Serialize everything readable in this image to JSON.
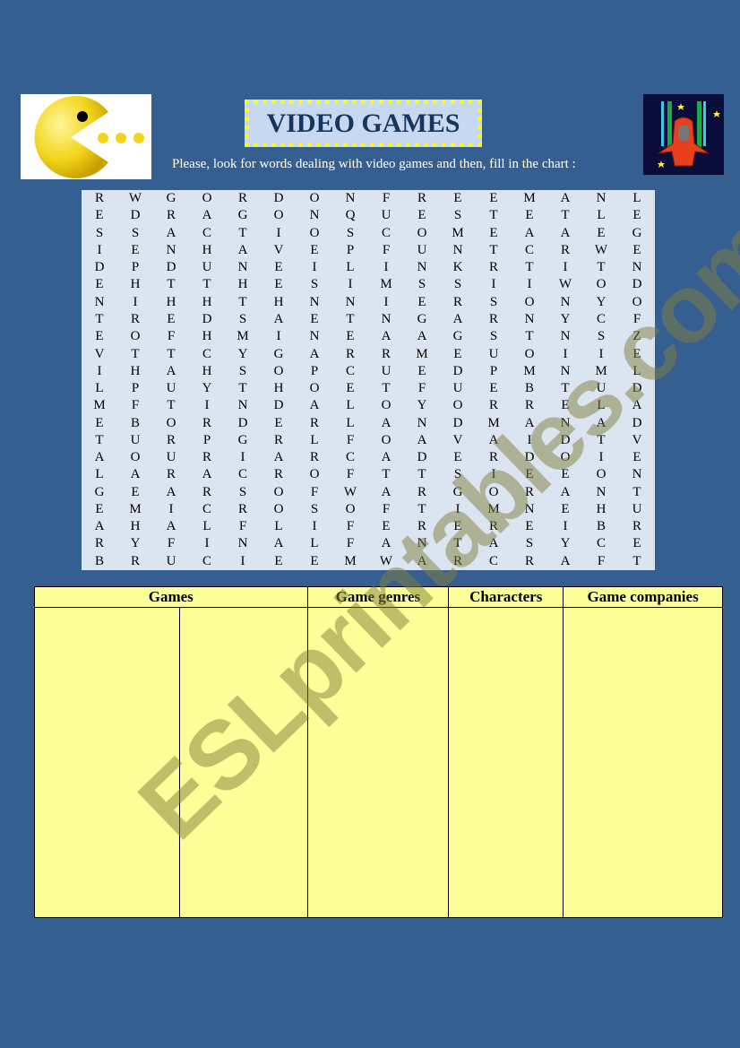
{
  "header": {
    "title": "VIDEO GAMES",
    "instructions": "Please, look for words dealing with video games and then, fill in the chart :",
    "left_image": "pacman-icon",
    "right_image": "spaceship-icon"
  },
  "word_search": {
    "rows": [
      [
        "R",
        "W",
        "G",
        "O",
        "R",
        "D",
        "O",
        "N",
        "F",
        "R",
        "E",
        "E",
        "M",
        "A",
        "N",
        "L"
      ],
      [
        "E",
        "D",
        "R",
        "A",
        "G",
        "O",
        "N",
        "Q",
        "U",
        "E",
        "S",
        "T",
        "E",
        "T",
        "L",
        "E"
      ],
      [
        "S",
        "S",
        "A",
        "C",
        "T",
        "I",
        "O",
        "S",
        "C",
        "O",
        "M",
        "E",
        "A",
        "A",
        "E",
        "G"
      ],
      [
        "I",
        "E",
        "N",
        "H",
        "A",
        "V",
        "E",
        "P",
        "F",
        "U",
        "N",
        "T",
        "C",
        "R",
        "W",
        "E"
      ],
      [
        "D",
        "P",
        "D",
        "U",
        "N",
        "E",
        "I",
        "L",
        "I",
        "N",
        "K",
        "R",
        "T",
        "I",
        "T",
        "N"
      ],
      [
        "E",
        "H",
        "T",
        "T",
        "H",
        "E",
        "S",
        "I",
        "M",
        "S",
        "S",
        "I",
        "I",
        "W",
        "O",
        "D"
      ],
      [
        "N",
        "I",
        "H",
        "H",
        "T",
        "H",
        "N",
        "N",
        "I",
        "E",
        "R",
        "S",
        "O",
        "N",
        "Y",
        "O"
      ],
      [
        "T",
        "R",
        "E",
        "D",
        "S",
        "A",
        "E",
        "T",
        "N",
        "G",
        "A",
        "R",
        "N",
        "Y",
        "C",
        "F"
      ],
      [
        "E",
        "O",
        "F",
        "H",
        "M",
        "I",
        "N",
        "E",
        "A",
        "A",
        "G",
        "S",
        "T",
        "N",
        "S",
        "Z"
      ],
      [
        "V",
        "T",
        "T",
        "C",
        "Y",
        "G",
        "A",
        "R",
        "R",
        "M",
        "E",
        "U",
        "O",
        "I",
        "I",
        "E"
      ],
      [
        "I",
        "H",
        "A",
        "H",
        "S",
        "O",
        "P",
        "C",
        "U",
        "E",
        "D",
        "P",
        "M",
        "N",
        "M",
        "L"
      ],
      [
        "L",
        "P",
        "U",
        "Y",
        "T",
        "H",
        "O",
        "E",
        "T",
        "F",
        "U",
        "E",
        "B",
        "T",
        "U",
        "D"
      ],
      [
        "M",
        "F",
        "T",
        "I",
        "N",
        "D",
        "A",
        "L",
        "O",
        "Y",
        "O",
        "R",
        "R",
        "E",
        "L",
        "A"
      ],
      [
        "E",
        "B",
        "O",
        "R",
        "D",
        "E",
        "R",
        "L",
        "A",
        "N",
        "D",
        "M",
        "A",
        "N",
        "A",
        "D"
      ],
      [
        "T",
        "U",
        "R",
        "P",
        "G",
        "R",
        "L",
        "F",
        "O",
        "A",
        "V",
        "A",
        "I",
        "D",
        "T",
        "V"
      ],
      [
        "A",
        "O",
        "U",
        "R",
        "I",
        "A",
        "R",
        "C",
        "A",
        "D",
        "E",
        "R",
        "D",
        "O",
        "I",
        "E"
      ],
      [
        "L",
        "A",
        "R",
        "A",
        "C",
        "R",
        "O",
        "F",
        "T",
        "T",
        "S",
        "I",
        "E",
        "E",
        "O",
        "N"
      ],
      [
        "G",
        "E",
        "A",
        "R",
        "S",
        "O",
        "F",
        "W",
        "A",
        "R",
        "G",
        "O",
        "R",
        "A",
        "N",
        "T"
      ],
      [
        "E",
        "M",
        "I",
        "C",
        "R",
        "O",
        "S",
        "O",
        "F",
        "T",
        "I",
        "M",
        "N",
        "E",
        "H",
        "U"
      ],
      [
        "A",
        "H",
        "A",
        "L",
        "F",
        "L",
        "I",
        "F",
        "E",
        "R",
        "E",
        "R",
        "E",
        "I",
        "B",
        "R"
      ],
      [
        "R",
        "Y",
        "F",
        "I",
        "N",
        "A",
        "L",
        "F",
        "A",
        "N",
        "T",
        "A",
        "S",
        "Y",
        "C",
        "E"
      ],
      [
        "B",
        "R",
        "U",
        "C",
        "I",
        "E",
        "E",
        "M",
        "W",
        "A",
        "R",
        "C",
        "R",
        "A",
        "F",
        "T"
      ]
    ]
  },
  "chart": {
    "headers": [
      "Games",
      "Game genres",
      "Characters",
      "Game companies"
    ]
  },
  "watermark": "ESLprintables.com",
  "colors": {
    "background": "#365f91",
    "grid_bg": "#dbe5f1",
    "table_bg": "#ffff99",
    "title_border": "#ffff00",
    "title_text": "#17365d"
  }
}
